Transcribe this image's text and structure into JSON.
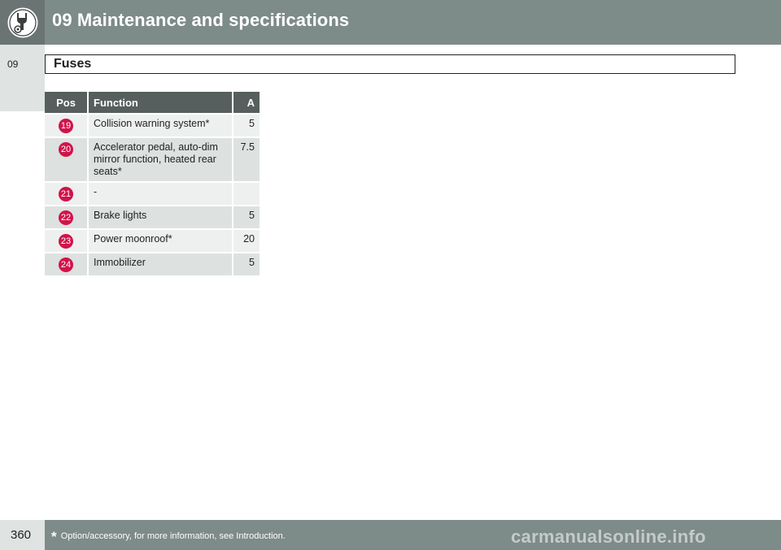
{
  "header": {
    "chapter_title": "09 Maintenance and specifications",
    "chapter_icon": "wrench-screwdriver-icon"
  },
  "side_tab": {
    "label": "09"
  },
  "section": {
    "title": "Fuses"
  },
  "table": {
    "columns": [
      "Pos",
      "Function",
      "A"
    ],
    "rows": [
      {
        "pos": "19",
        "function": "Collision warning system*",
        "amps": "5"
      },
      {
        "pos": "20",
        "function": "Accelerator pedal, auto-dim mirror function, heated rear seats*",
        "amps": "7.5"
      },
      {
        "pos": "21",
        "function": "-",
        "amps": ""
      },
      {
        "pos": "22",
        "function": "Brake lights",
        "amps": "5"
      },
      {
        "pos": "23",
        "function": "Power moonroof*",
        "amps": "20"
      },
      {
        "pos": "24",
        "function": "Immobilizer",
        "amps": "5"
      }
    ],
    "badge_color": "#d2134a",
    "header_color": "#565f5e"
  },
  "footer": {
    "page_number": "360",
    "footnote_star": "*",
    "footnote_text": "Option/accessory, for more information, see Introduction."
  },
  "watermark": "carmanualsonline.info"
}
